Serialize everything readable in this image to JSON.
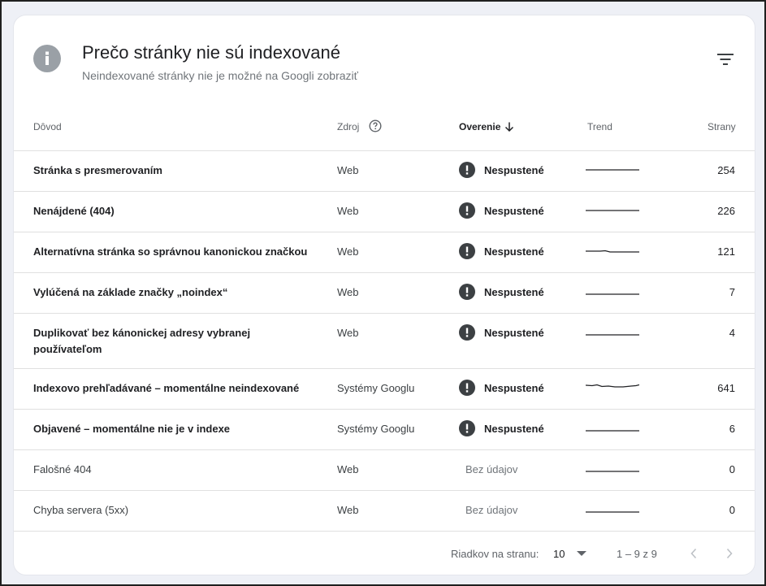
{
  "header": {
    "title": "Prečo stránky nie sú indexované",
    "subtitle": "Neindexované stránky nie je možné na Googli zobraziť",
    "info_icon": "info-icon",
    "filter_icon": "filter-icon"
  },
  "columns": {
    "reason": "Dôvod",
    "source": "Zdroj",
    "validation": "Overenie",
    "trend": "Trend",
    "pages": "Strany"
  },
  "rows": [
    {
      "reason": "Stránka s presmerovaním",
      "source": "Web",
      "validation": "Nespustené",
      "pages": "254",
      "bold": true
    },
    {
      "reason": "Nenájdené (404)",
      "source": "Web",
      "validation": "Nespustené",
      "pages": "226",
      "bold": true
    },
    {
      "reason": "Alternatívna stránka so správnou kanonickou značkou",
      "source": "Web",
      "validation": "Nespustené",
      "pages": "121",
      "bold": true
    },
    {
      "reason": "Vylúčená na základe značky „noindex“",
      "source": "Web",
      "validation": "Nespustené",
      "pages": "7",
      "bold": true
    },
    {
      "reason": "Duplikovať bez kánonickej adresy vybranej používateľom",
      "source": "Web",
      "validation": "Nespustené",
      "pages": "4",
      "bold": true
    },
    {
      "reason": "Indexovo prehľadávané – momentálne neindexované",
      "source": "Systémy Googlu",
      "validation": "Nespustené",
      "pages": "641",
      "bold": true
    },
    {
      "reason": "Objavené – momentálne nie je v indexe",
      "source": "Systémy Googlu",
      "validation": "Nespustené",
      "pages": "6",
      "bold": true
    },
    {
      "reason": "Falošné 404",
      "source": "Web",
      "validation": "Bez údajov",
      "pages": "0",
      "bold": false
    },
    {
      "reason": "Chyba servera (5xx)",
      "source": "Web",
      "validation": "Bez údajov",
      "pages": "0",
      "bold": false
    }
  ],
  "pagination": {
    "rows_per_page_label": "Riadkov na stranu:",
    "rows_per_page_value": "10",
    "range": "1 – 9 z 9"
  },
  "colors": {
    "warning_icon": "#3c4043",
    "info_icon": "#9aa0a6",
    "trend_line": "#202124"
  }
}
